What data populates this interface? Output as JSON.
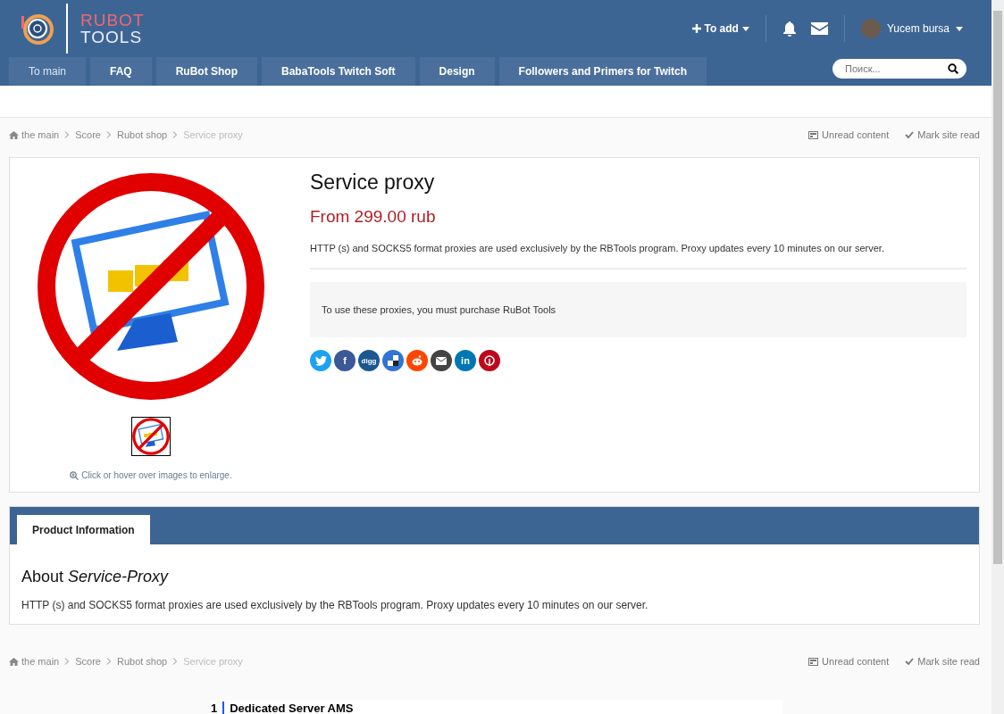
{
  "logo": {
    "line_1": "RUBOT",
    "line_2": "TOOLS"
  },
  "user_bar": {
    "add_button": "To add",
    "user_name": "Yucem bursa"
  },
  "nav": [
    {
      "label": "To main",
      "selected": true
    },
    {
      "label": "FAQ",
      "selected": false
    },
    {
      "label": "RuBot Shop",
      "selected": false
    },
    {
      "label": "BabaTools Twitch Soft",
      "selected": false
    },
    {
      "label": "Design",
      "selected": false
    },
    {
      "label": "Followers and Primers for Twitch",
      "selected": false
    }
  ],
  "search": {
    "placeholder": "Поиск..."
  },
  "breadcrumb_top": {
    "items": [
      "the main",
      "Score",
      "Rubot shop",
      "Service proxy"
    ],
    "actions": [
      "Unread content",
      "Mark site read"
    ]
  },
  "product": {
    "title": "Service proxy",
    "price": "From 299.00 rub",
    "summary": "HTTP (s) and SOCKS5 format proxies are used exclusively by the RBTools program. Proxy updates every 10 minutes on our server.",
    "notice": "To use these proxies, you must purchase RuBot Tools",
    "caption": "Click or hover over images to enlarge.",
    "share_buttons": [
      {
        "kind": "twitter"
      },
      {
        "kind": "facebook",
        "glyph": "f"
      },
      {
        "kind": "digg",
        "glyph": "digg"
      },
      {
        "kind": "delicious"
      },
      {
        "kind": "reddit"
      },
      {
        "kind": "email"
      },
      {
        "kind": "linkedin",
        "glyph": "in"
      },
      {
        "kind": "pinterest"
      }
    ]
  },
  "info_tabs": [
    {
      "label": "Product Information",
      "selected": true
    }
  ],
  "about": {
    "heading": "About *Service-Proxy*",
    "text": "HTTP (s) and SOCKS5 format proxies are used exclusively by the RBTools program. Proxy updates every 10 minutes on our server."
  },
  "breadcrumb_bottom": {
    "items": [
      "the main",
      "Score",
      "Rubot shop",
      "Service proxy"
    ],
    "actions": [
      "Unread content",
      "Mark site read"
    ]
  },
  "ad": {
    "number": "1",
    "title": "Dedicated Server AMS"
  }
}
